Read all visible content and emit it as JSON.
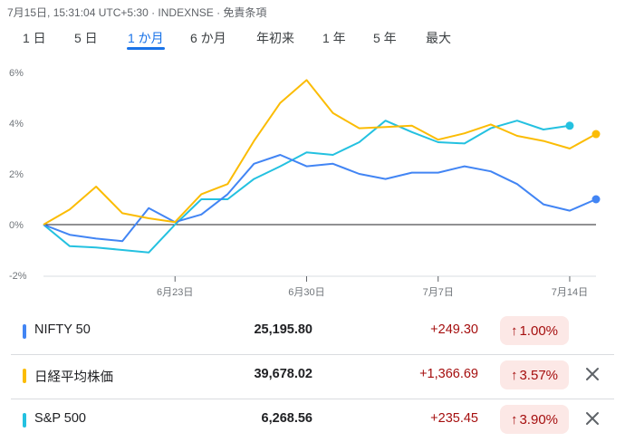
{
  "header": {
    "meta_text": "7月15日, 15:31:04 UTC+5:30 · INDEXNSE · 免責条項"
  },
  "tabs": [
    {
      "label": "1 日",
      "active": false
    },
    {
      "label": "5 日",
      "active": false
    },
    {
      "label": "1 か月",
      "active": true
    },
    {
      "label": "6 か月",
      "active": false
    },
    {
      "label": "年初来",
      "active": false
    },
    {
      "label": "1 年",
      "active": false
    },
    {
      "label": "5 年",
      "active": false
    },
    {
      "label": "最大",
      "active": false
    }
  ],
  "chart_data": {
    "type": "line",
    "x_ticks": [
      "6月23日",
      "6月30日",
      "7月7日",
      "7月14日"
    ],
    "y_ticks": [
      "6%",
      "4%",
      "2%",
      "0%",
      "-2%"
    ],
    "ylim": [
      -2,
      6
    ],
    "series": [
      {
        "name": "NIFTY 50",
        "color": "#4285f4",
        "values": [
          0.0,
          -0.4,
          -0.55,
          -0.65,
          0.65,
          0.1,
          0.4,
          1.2,
          2.4,
          2.75,
          2.3,
          2.4,
          2.0,
          1.8,
          2.05,
          2.05,
          2.3,
          2.1,
          1.6,
          0.8,
          0.55,
          1.0
        ]
      },
      {
        "name": "日経平均株価",
        "color": "#fbbc04",
        "values": [
          0.0,
          0.6,
          1.5,
          0.45,
          0.25,
          0.1,
          1.2,
          1.6,
          3.3,
          4.8,
          5.7,
          4.4,
          3.8,
          3.85,
          3.9,
          3.35,
          3.6,
          3.95,
          3.5,
          3.3,
          3.0,
          3.57
        ]
      },
      {
        "name": "S&P 500",
        "color": "#24c1e0",
        "values": [
          0.0,
          -0.85,
          -0.9,
          -1.0,
          -1.1,
          0.0,
          1.0,
          1.0,
          1.8,
          2.3,
          2.85,
          2.75,
          3.25,
          4.1,
          3.65,
          3.25,
          3.2,
          3.8,
          4.1,
          3.75,
          3.9
        ]
      }
    ]
  },
  "table": {
    "rows": [
      {
        "name": "NIFTY 50",
        "price": "25,195.80",
        "change": "+249.30",
        "pct": "1.00%",
        "arrow": "↑",
        "color": "#4285f4",
        "removable": false
      },
      {
        "name": "日経平均株価",
        "price": "39,678.02",
        "change": "+1,366.69",
        "pct": "3.57%",
        "arrow": "↑",
        "color": "#fbbc04",
        "removable": true
      },
      {
        "name": "S&P 500",
        "price": "6,268.56",
        "change": "+235.45",
        "pct": "3.90%",
        "arrow": "↑",
        "color": "#24c1e0",
        "removable": true
      }
    ]
  }
}
